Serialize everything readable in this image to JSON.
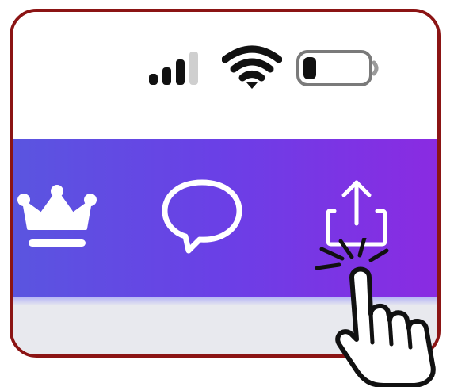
{
  "status_bar": {
    "signal_icon": "cellular-signal-icon",
    "signal_bars_active": 3,
    "signal_bars_total": 4,
    "wifi_icon": "wifi-icon",
    "battery_icon": "battery-icon",
    "battery_level": 0.2
  },
  "toolbar": {
    "gradient_start": "#5a55e0",
    "gradient_end": "#8a2be2",
    "buttons": [
      {
        "icon": "crown-icon",
        "role": "premium"
      },
      {
        "icon": "chat-bubble-icon",
        "role": "comments"
      },
      {
        "icon": "share-upload-icon",
        "role": "share"
      }
    ]
  },
  "overlay": {
    "icon": "tap-hand-pointer-icon"
  },
  "colors": {
    "frame_border": "#8b1414",
    "content_background": "#e8e9ee"
  }
}
